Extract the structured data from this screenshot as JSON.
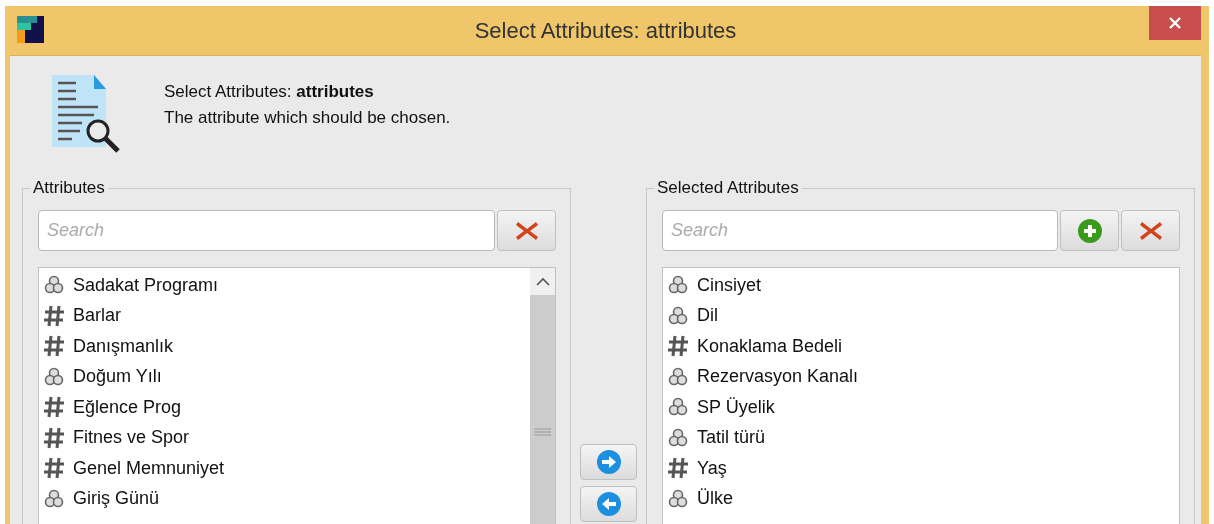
{
  "window": {
    "title": "Select Attributes: attributes"
  },
  "header": {
    "title": "Select Attributes: **attributes**",
    "description": "The attribute which should be chosen."
  },
  "available": {
    "legend": "Attributes",
    "search": {
      "placeholder": "Search"
    },
    "items": [
      {
        "label": "Sadakat Programı",
        "kind": "nominal"
      },
      {
        "label": "Barlar",
        "kind": "numeric"
      },
      {
        "label": "Danışmanlık",
        "kind": "numeric"
      },
      {
        "label": "Doğum Yılı",
        "kind": "nominal"
      },
      {
        "label": "Eğlence Prog",
        "kind": "numeric"
      },
      {
        "label": "Fitnes ve Spor",
        "kind": "numeric"
      },
      {
        "label": "Genel Memnuniyet",
        "kind": "numeric"
      },
      {
        "label": "Giriş Günü",
        "kind": "nominal"
      }
    ]
  },
  "selected": {
    "legend": "Selected Attributes",
    "search": {
      "placeholder": "Search"
    },
    "items": [
      {
        "label": "Cinsiyet",
        "kind": "nominal"
      },
      {
        "label": "Dil",
        "kind": "nominal"
      },
      {
        "label": "Konaklama Bedeli",
        "kind": "numeric"
      },
      {
        "label": "Rezervasyon Kanalı",
        "kind": "nominal"
      },
      {
        "label": "SP Üyelik",
        "kind": "nominal"
      },
      {
        "label": "Tatil türü",
        "kind": "nominal"
      },
      {
        "label": "Yaş",
        "kind": "numeric"
      },
      {
        "label": "Ülke",
        "kind": "nominal"
      }
    ]
  }
}
